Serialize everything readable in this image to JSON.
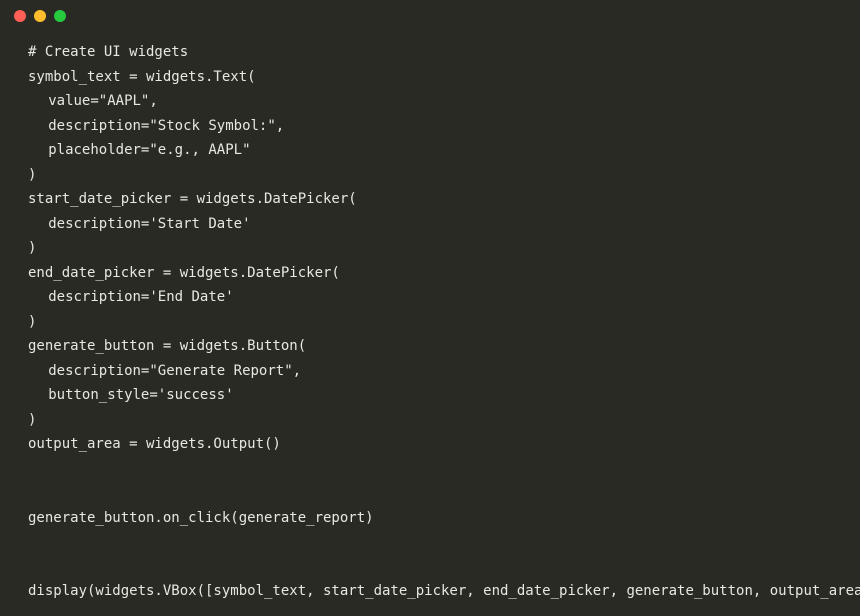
{
  "code": {
    "lines": [
      {
        "text": "# Create UI widgets",
        "indent": 0
      },
      {
        "text": "symbol_text = widgets.Text(",
        "indent": 0
      },
      {
        "text": "value=\"AAPL\",",
        "indent": 1
      },
      {
        "text": "description=\"Stock Symbol:\",",
        "indent": 1
      },
      {
        "text": "placeholder=\"e.g., AAPL\"",
        "indent": 1
      },
      {
        "text": ")",
        "indent": 0
      },
      {
        "text": "start_date_picker = widgets.DatePicker(",
        "indent": 0
      },
      {
        "text": "description='Start Date'",
        "indent": 1
      },
      {
        "text": ")",
        "indent": 0
      },
      {
        "text": "end_date_picker = widgets.DatePicker(",
        "indent": 0
      },
      {
        "text": "description='End Date'",
        "indent": 1
      },
      {
        "text": ")",
        "indent": 0
      },
      {
        "text": "generate_button = widgets.Button(",
        "indent": 0
      },
      {
        "text": "description=\"Generate Report\",",
        "indent": 1
      },
      {
        "text": "button_style='success'",
        "indent": 1
      },
      {
        "text": ")",
        "indent": 0
      },
      {
        "text": "output_area = widgets.Output()",
        "indent": 0
      },
      {
        "text": "",
        "indent": 0
      },
      {
        "text": "",
        "indent": 0
      },
      {
        "text": "generate_button.on_click(generate_report)",
        "indent": 0
      },
      {
        "text": "",
        "indent": 0
      },
      {
        "text": "",
        "indent": 0
      },
      {
        "text": "display(widgets.VBox([symbol_text, start_date_picker, end_date_picker, generate_button, output_area]))",
        "indent": 0
      }
    ]
  }
}
